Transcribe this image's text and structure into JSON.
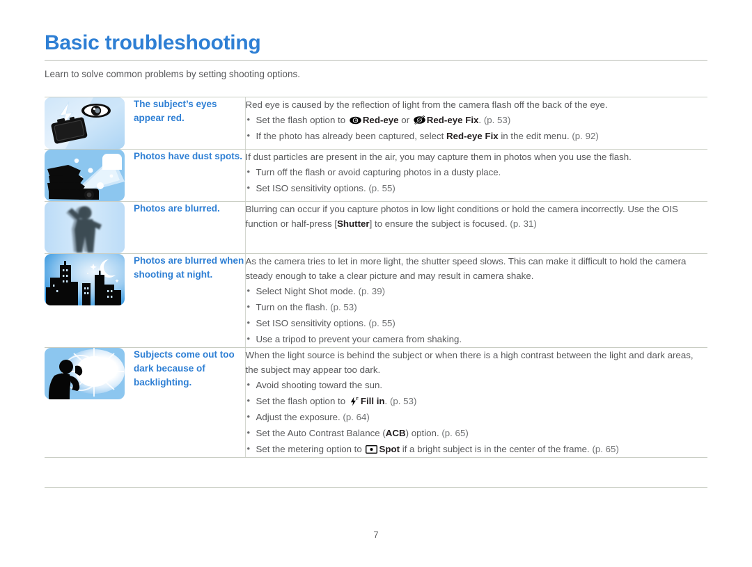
{
  "header": {
    "title": "Basic troubleshooting",
    "subtitle": "Learn to solve common problems by setting shooting options.",
    "accent_color": "#2e7fd4",
    "rule_color": "#b9bdb4"
  },
  "footer": {
    "page_number": "7"
  },
  "rows": [
    {
      "image_name": "red-eye-flash-illustration",
      "symptom": "The subject’s eyes appear red.",
      "intro": "Red eye is caused by the reflection of light from the camera flash off the back of the eye.",
      "bullets": [
        {
          "segments": [
            {
              "t": "Set the flash option to "
            },
            {
              "icon": "red-eye-icon"
            },
            {
              "t": "Red-eye",
              "bold": true
            },
            {
              "t": " or "
            },
            {
              "icon": "red-eye-fix-icon"
            },
            {
              "t": "Red-eye Fix",
              "bold": true
            },
            {
              "t": ". "
            },
            {
              "t": "(p. 53)",
              "ref": true
            }
          ]
        },
        {
          "segments": [
            {
              "t": "If the photo has already been captured, select "
            },
            {
              "t": "Red-eye Fix",
              "bold": true
            },
            {
              "t": " in the edit menu. "
            },
            {
              "t": "(p. 92)",
              "ref": true
            }
          ]
        }
      ]
    },
    {
      "image_name": "dust-spots-illustration",
      "symptom": "Photos have dust spots.",
      "intro": "If dust particles are present in the air, you may capture them in photos when you use the flash.",
      "bullets": [
        {
          "segments": [
            {
              "t": "Turn off the flash or avoid capturing photos in a dusty place."
            }
          ]
        },
        {
          "segments": [
            {
              "t": "Set ISO sensitivity options. "
            },
            {
              "t": "(p. 55)",
              "ref": true
            }
          ]
        }
      ]
    },
    {
      "image_name": "blurred-person-illustration",
      "symptom": "Photos are blurred.",
      "intro_segments": [
        {
          "t": "Blurring can occur if you capture photos in low light conditions or hold the camera incorrectly. Use the OIS function or half-press ["
        },
        {
          "t": "Shutter",
          "bold": true
        },
        {
          "t": "] to ensure the subject is focused. "
        },
        {
          "t": "(p. 31)",
          "ref": true
        }
      ],
      "bullets": []
    },
    {
      "image_name": "night-cityscape-illustration",
      "symptom": "Photos are blurred when shooting at night.",
      "intro": "As the camera tries to let in more light, the shutter speed slows. This can make it difficult to hold the camera steady enough to take a clear picture and may result in camera shake.",
      "bullets": [
        {
          "segments": [
            {
              "t": "Select Night Shot mode. "
            },
            {
              "t": "(p. 39)",
              "ref": true
            }
          ]
        },
        {
          "segments": [
            {
              "t": "Turn on the flash. "
            },
            {
              "t": "(p. 53)",
              "ref": true
            }
          ]
        },
        {
          "segments": [
            {
              "t": "Set ISO sensitivity options. "
            },
            {
              "t": "(p. 55)",
              "ref": true
            }
          ]
        },
        {
          "segments": [
            {
              "t": "Use a tripod to prevent your camera from shaking."
            }
          ]
        }
      ]
    },
    {
      "image_name": "backlighting-illustration",
      "symptom": "Subjects come out too dark because of backlighting.",
      "intro": "When the light source is behind the subject or when there is a high contrast between the light and dark areas, the subject may appear too dark.",
      "bullets": [
        {
          "segments": [
            {
              "t": "Avoid shooting toward the sun."
            }
          ]
        },
        {
          "segments": [
            {
              "t": "Set the flash option to "
            },
            {
              "icon": "fill-in-flash-icon"
            },
            {
              "t": "Fill in",
              "bold": true
            },
            {
              "t": ". "
            },
            {
              "t": "(p. 53)",
              "ref": true
            }
          ]
        },
        {
          "segments": [
            {
              "t": "Adjust the exposure. "
            },
            {
              "t": "(p. 64)",
              "ref": true
            }
          ]
        },
        {
          "segments": [
            {
              "t": "Set the Auto Contrast Balance ("
            },
            {
              "t": "ACB",
              "bold": true
            },
            {
              "t": ") option. "
            },
            {
              "t": "(p. 65)",
              "ref": true
            }
          ]
        },
        {
          "segments": [
            {
              "t": "Set the metering option to "
            },
            {
              "icon": "spot-metering-icon"
            },
            {
              "t": "Spot",
              "bold": true
            },
            {
              "t": " if a bright subject is in the center of the frame. "
            },
            {
              "t": "(p. 65)",
              "ref": true
            }
          ]
        }
      ]
    }
  ]
}
